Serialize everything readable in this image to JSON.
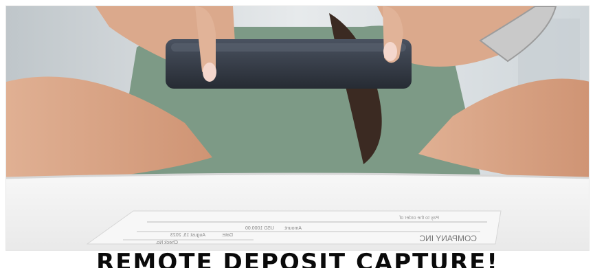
{
  "image": {
    "alt_subject": "photo-check-with-phone"
  },
  "caption": {
    "text": "REMOTE DEPOSIT CAPTURE!"
  },
  "check": {
    "company": "COMPANY INC",
    "amount_label": "Amount:",
    "amount_value": "USD 1000.00",
    "date_label": "Date:",
    "date_value": "August 15, 2023",
    "check_no": "Check No.",
    "pay_to": "Pay to the order of"
  },
  "colors": {
    "shirt": "#7d9a86",
    "phone": "#2f3540",
    "skin": "#d9a486",
    "table": "#f2f2f2",
    "caption": "#0a0a0a"
  }
}
